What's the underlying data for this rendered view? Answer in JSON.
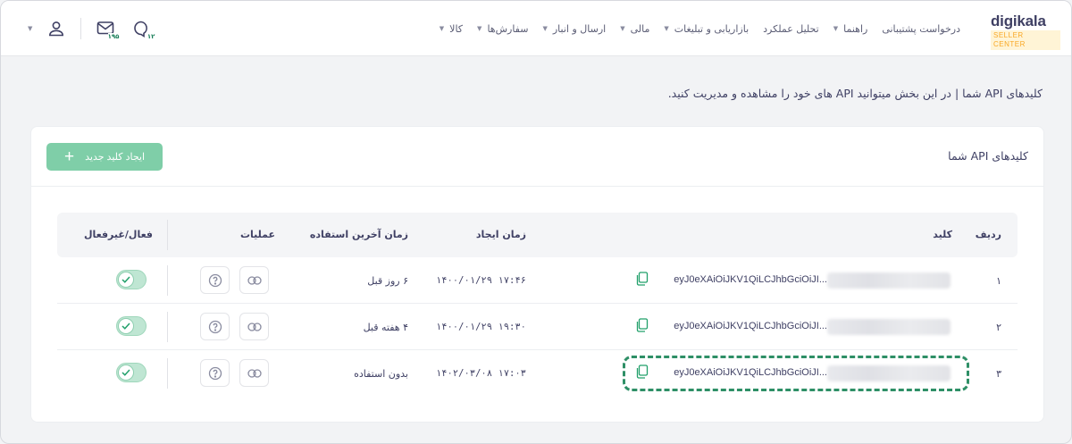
{
  "header": {
    "logo": {
      "brand": "digikala",
      "sub": "SELLER CENTER"
    },
    "nav": [
      {
        "label": "کالا",
        "has_caret": true
      },
      {
        "label": "سفارش‌ها",
        "has_caret": true
      },
      {
        "label": "ارسال و انبار",
        "has_caret": true
      },
      {
        "label": "مالی",
        "has_caret": true
      },
      {
        "label": "بازاریابی و تبلیغات",
        "has_caret": true
      },
      {
        "label": "تحلیل عملکرد",
        "has_caret": false
      },
      {
        "label": "راهنما",
        "has_caret": true
      },
      {
        "label": "درخواست پشتیبانی",
        "has_caret": false
      }
    ],
    "icons": {
      "support_badge": "۱۲",
      "messages_badge": "۱۹۵"
    }
  },
  "intro_text": "کلیدهای API شما | در این بخش میتوانید API های خود را مشاهده و مدیریت کنید.",
  "card": {
    "title": "کلیدهای API شما",
    "new_button_label": "ایجاد کلید جدید"
  },
  "table": {
    "columns": {
      "row": "ردیف",
      "key": "کلید",
      "created": "زمان ایجاد",
      "last_used": "زمان آخرین استفاده",
      "operations": "عملیات",
      "active": "فعال/غیرفعال"
    },
    "rows": [
      {
        "index": "۱",
        "key": "eyJ0eXAiOiJKV1QiLCJhbGciOiJI...",
        "created": "۱۷:۴۶ ۱۴۰۰/۰۱/۲۹",
        "last_used": "۶ روز قبل"
      },
      {
        "index": "۲",
        "key": "eyJ0eXAiOiJKV1QiLCJhbGciOiJI...",
        "created": "۱۹:۳۰ ۱۴۰۰/۰۱/۲۹",
        "last_used": "۴ هفته قبل"
      },
      {
        "index": "۳",
        "key": "eyJ0eXAiOiJKV1QiLCJhbGciOiJI...",
        "created": "۱۷:۰۳ ۱۴۰۲/۰۳/۰۸",
        "last_used": "بدون استفاده"
      }
    ]
  },
  "colors": {
    "accent": "#7fcea8",
    "highlight": "#2e8f66",
    "text": "#3f4064"
  }
}
